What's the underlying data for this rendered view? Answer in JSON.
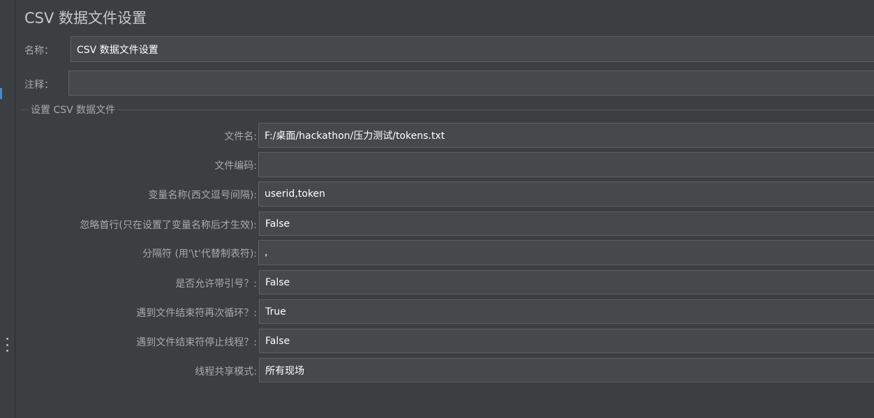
{
  "panel": {
    "title": "CSV 数据文件设置"
  },
  "name_field": {
    "label": "名称：",
    "value": "CSV 数据文件设置"
  },
  "comment_field": {
    "label": "注释：",
    "value": ""
  },
  "group": {
    "title": "设置 CSV 数据文件"
  },
  "form": {
    "filename": {
      "label": "文件名:",
      "value": "F:/桌面/hackathon/压力测试/tokens.txt"
    },
    "encoding": {
      "label": "文件编码:",
      "value": ""
    },
    "variable_names": {
      "label": "变量名称(西文逗号间隔):",
      "value": "userid,token"
    },
    "ignore_first_line": {
      "label": "忽略首行(只在设置了变量名称后才生效):",
      "value": "False"
    },
    "delimiter": {
      "label": "分隔符 (用'\\t'代替制表符):",
      "value": ","
    },
    "allow_quoted": {
      "label": "是否允许带引号？:",
      "value": "False"
    },
    "recycle_eof": {
      "label": "遇到文件结束符再次循环？:",
      "value": "True"
    },
    "stop_thread_eof": {
      "label": "遇到文件结束符停止线程？:",
      "value": "False"
    },
    "sharing_mode": {
      "label": "线程共享模式:",
      "value": "所有现场"
    }
  }
}
